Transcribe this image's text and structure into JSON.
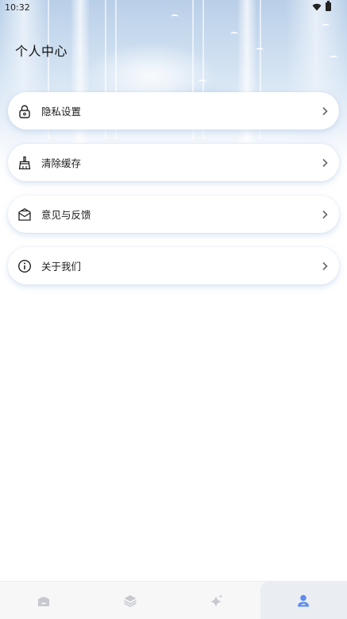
{
  "status_bar": {
    "time": "10:32",
    "wifi_icon": "wifi-icon",
    "battery_icon": "battery-icon"
  },
  "header": {
    "title": "个人中心"
  },
  "menu": {
    "items": [
      {
        "label": "隐私设置",
        "icon": "lock-icon"
      },
      {
        "label": "清除缓存",
        "icon": "broom-icon"
      },
      {
        "label": "意见与反馈",
        "icon": "mail-icon"
      },
      {
        "label": "关于我们",
        "icon": "info-icon"
      }
    ],
    "chevron_icon": "chevron-right-icon"
  },
  "tab_bar": {
    "tabs": [
      {
        "icon": "home-icon",
        "active": false
      },
      {
        "icon": "layers-icon",
        "active": false
      },
      {
        "icon": "sparkle-icon",
        "active": false
      },
      {
        "icon": "user-icon",
        "active": true
      }
    ],
    "active_color": "#5b8def",
    "inactive_color": "#c7c9cf"
  }
}
